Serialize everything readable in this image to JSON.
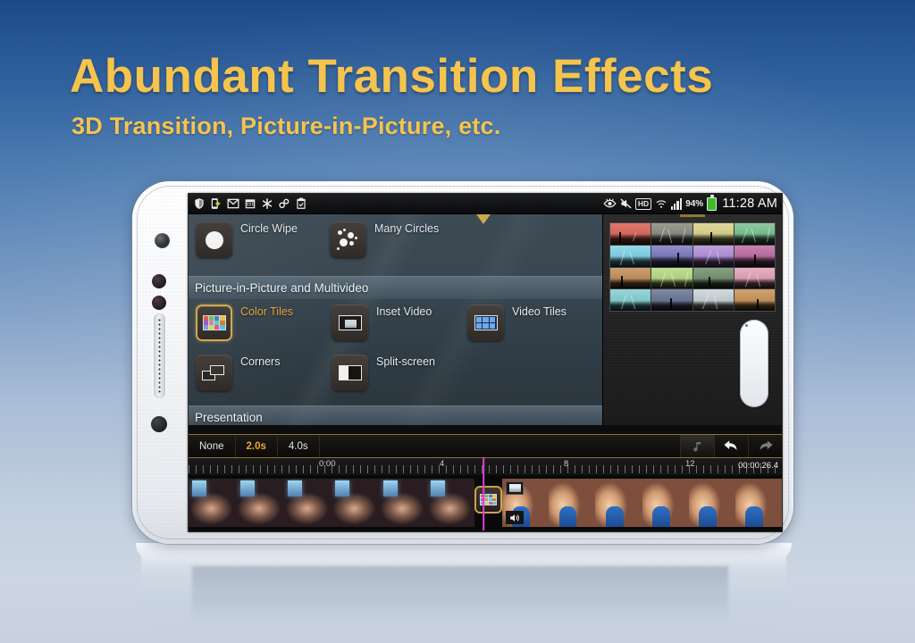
{
  "promo": {
    "headline": "Abundant Transition Effects",
    "subhead": "3D Transition, Picture-in-Picture, etc.",
    "accent_color": "#f5c44e",
    "background_top_color": "#1b4a87",
    "background_bottom_color": "#ccd6e2"
  },
  "device": {
    "name": "white-smartphone",
    "orientation": "landscape",
    "hardware": {
      "camera": "front-camera",
      "sensor_1": "proximity-sensor",
      "sensor_2": "light-sensor",
      "earpiece": "speaker-grille",
      "home_button": "home-button"
    }
  },
  "statusbar": {
    "left_icons": [
      "shield-icon",
      "phone-transfer-icon",
      "mail-icon",
      "calendar-icon",
      "asterisk-icon",
      "link-icon",
      "clipboard-check-icon"
    ],
    "right_icons": [
      "eye-icon",
      "mute-icon",
      "hd-icon",
      "wifi-icon",
      "signal-icon"
    ],
    "hd_label": "HD",
    "battery_percent": "94%",
    "clock": "11:28 AM"
  },
  "effects_panel": {
    "rows": [
      {
        "items": [
          {
            "label": "Circle Wipe",
            "icon": "circle-wipe-icon",
            "selected": false
          },
          {
            "label": "Many Circles",
            "icon": "many-circles-icon",
            "selected": false
          }
        ]
      }
    ],
    "section_header": "Picture-in-Picture and Multivideo",
    "pip_rows": [
      {
        "items": [
          {
            "label": "Color Tiles",
            "icon": "color-tiles-icon",
            "selected": true
          },
          {
            "label": "Inset Video",
            "icon": "inset-video-icon",
            "selected": false
          },
          {
            "label": "Video Tiles",
            "icon": "video-tiles-icon",
            "selected": false
          }
        ]
      },
      {
        "items": [
          {
            "label": "Corners",
            "icon": "corners-icon",
            "selected": false
          },
          {
            "label": "Split-screen",
            "icon": "split-screen-icon",
            "selected": false
          }
        ]
      }
    ],
    "next_section_header": "Presentation",
    "selected_color": "#e8a93c"
  },
  "preview": {
    "name": "color-tiles-preview",
    "grid_rows": 4,
    "grid_cols": 4,
    "tile_colors": [
      "#e0736b",
      "#8d8f84",
      "#d9c濃",
      "#7fc39a",
      "#8fd6e8",
      "#8f8cc8",
      "#b79ad8",
      "#c57fae",
      "#c79a6a",
      "#b9d98f",
      "#7f9a7a",
      "#e4a8bc",
      "#8fd0d8",
      "#6f7f99",
      "#c9d3d8",
      "#c89a6a"
    ]
  },
  "toolbar": {
    "duration_options": [
      {
        "label": "None",
        "selected": false
      },
      {
        "label": "2.0s",
        "selected": true
      },
      {
        "label": "4.0s",
        "selected": false
      }
    ],
    "music_icon": "music-note-icon",
    "undo_icon": "undo-icon",
    "redo_icon": "redo-icon"
  },
  "timeline": {
    "tick_labels": [
      "0:00",
      "4",
      "8",
      "12"
    ],
    "total_duration": "00:00:26.4",
    "playhead_position_label": "0:00",
    "clips": [
      {
        "name": "clip-a",
        "frames": 6
      },
      {
        "name": "clip-b",
        "frames": 6
      }
    ],
    "transition_marker": "color-tiles-transition",
    "pip_badge_icon": "pip-icon",
    "speaker_badge_icon": "speaker-icon"
  }
}
